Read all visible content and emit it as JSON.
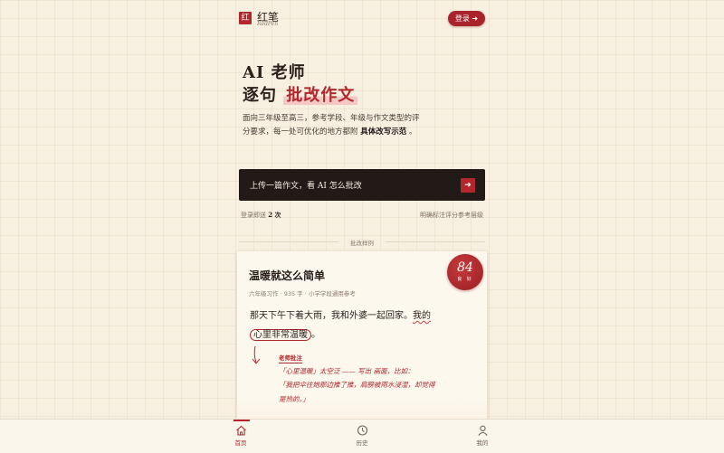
{
  "brand": {
    "mark": "红",
    "name": "红笔",
    "sub": "RedPen"
  },
  "header": {
    "login_label": "登录 ➜"
  },
  "hero": {
    "line1": "AI 老师",
    "line2_prefix": "逐句",
    "line2_highlight": "批改作文",
    "desc_text": "面向三年级至高三，参考学段、年级与作文类型的评分要求，每一处可优化的地方都附",
    "desc_bold": "具体改写示范",
    "desc_end": "。"
  },
  "upload": {
    "label": "上传一篇作文，看 AI 怎么批改",
    "arrow": "➜"
  },
  "meta": {
    "left_prefix": "登录即送",
    "left_count": "2 次",
    "right": "明确标注评分参考层级"
  },
  "sample": {
    "label": "批改样例"
  },
  "card": {
    "title": "温暖就这么简单",
    "meta": "六年级习作 · 935 字 · 小学学段通用参考",
    "score": "84",
    "score_label": "良 好",
    "essay_line1_a": "那天下午下着大雨，我和外婆一起回家。",
    "essay_line1_b": "我的",
    "essay_line2_circled": "心里非常温暖",
    "essay_line2_end": "。",
    "comment_label": "老师批注",
    "comment_line1": "「心里温暖」太空泛 —— 写出 画面，比如：",
    "comment_line2": "「我把伞往她那边推了推，肩膀被雨水浸湿，却觉得",
    "comment_line3": "是热的。」"
  },
  "nav": {
    "home": "首页",
    "history": "历史",
    "mine": "我的"
  },
  "colors": {
    "accent": "#b3262b",
    "ink": "#221a17",
    "paper": "#f7efe0"
  }
}
